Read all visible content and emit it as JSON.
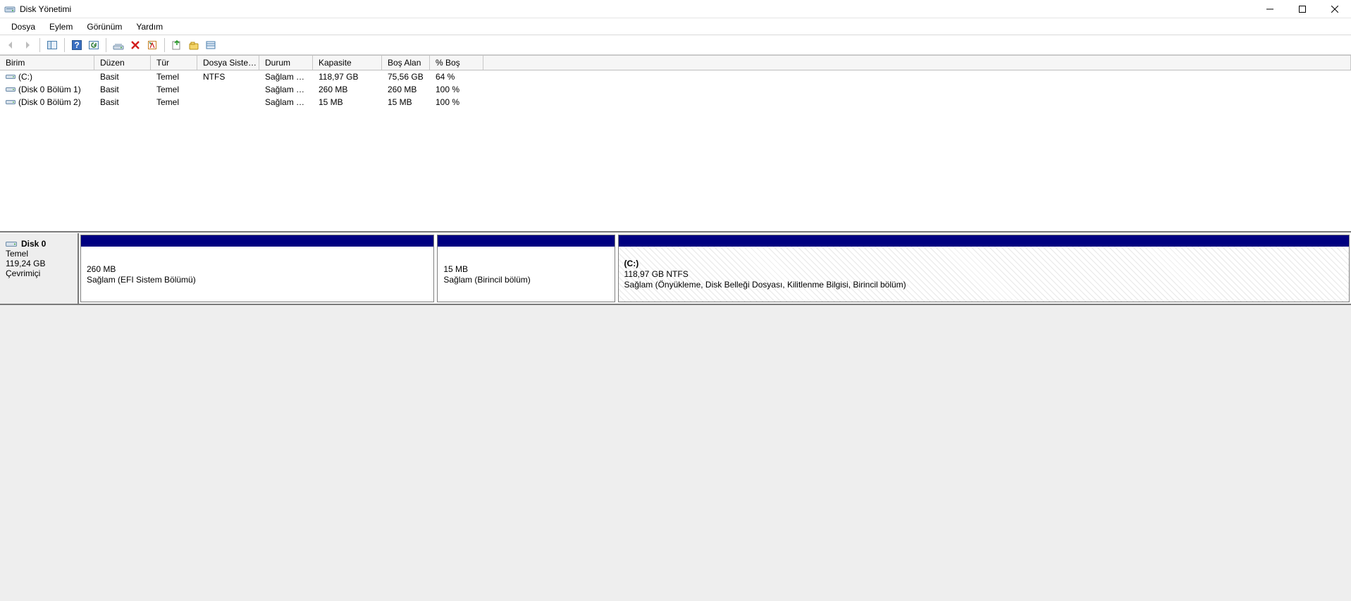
{
  "window": {
    "title": "Disk Yönetimi"
  },
  "menu": {
    "items": [
      "Dosya",
      "Eylem",
      "Görünüm",
      "Yardım"
    ]
  },
  "columns": {
    "birim": "Birim",
    "duzen": "Düzen",
    "tur": "Tür",
    "dosya": "Dosya Siste…",
    "durum": "Durum",
    "kapasite": "Kapasite",
    "bosalan": "Boş Alan",
    "bos": "% Boş"
  },
  "volumes": [
    {
      "name": "(C:)",
      "duzen": "Basit",
      "tur": "Temel",
      "fs": "NTFS",
      "durum": "Sağlam (Ö…",
      "kapasite": "118,97 GB",
      "bosalan": "75,56 GB",
      "bos": "64 %"
    },
    {
      "name": "(Disk 0 Bölüm 1)",
      "duzen": "Basit",
      "tur": "Temel",
      "fs": "",
      "durum": "Sağlam (E…",
      "kapasite": "260 MB",
      "bosalan": "260 MB",
      "bos": "100 %"
    },
    {
      "name": "(Disk 0 Bölüm 2)",
      "duzen": "Basit",
      "tur": "Temel",
      "fs": "",
      "durum": "Sağlam (Bi…",
      "kapasite": "15 MB",
      "bosalan": "15 MB",
      "bos": "100 %"
    }
  ],
  "disk": {
    "name": "Disk 0",
    "type": "Temel",
    "size": "119,24 GB",
    "status": "Çevrimiçi",
    "partitions": [
      {
        "label": "",
        "size": "260 MB",
        "status": "Sağlam (EFI Sistem Bölümü)",
        "hatched": false,
        "flex": 28
      },
      {
        "label": "",
        "size": "15 MB",
        "status": "Sağlam (Birincil bölüm)",
        "hatched": false,
        "flex": 14
      },
      {
        "label": "(C:)",
        "size": "118,97 GB NTFS",
        "status": "Sağlam (Önyükleme, Disk Belleği Dosyası, Kilitlenme Bilgisi, Birincil bölüm)",
        "hatched": true,
        "flex": 58
      }
    ]
  }
}
